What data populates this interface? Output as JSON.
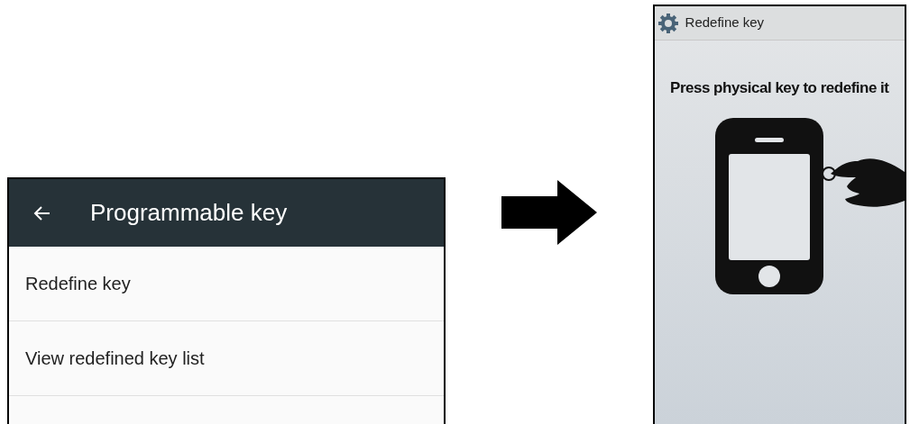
{
  "settings_screen": {
    "title": "Programmable key",
    "items": [
      {
        "label": "Redefine key"
      },
      {
        "label": "View redefined key list"
      }
    ]
  },
  "redefine_screen": {
    "title": "Redefine key",
    "instruction": "Press physical key to redefine it"
  }
}
